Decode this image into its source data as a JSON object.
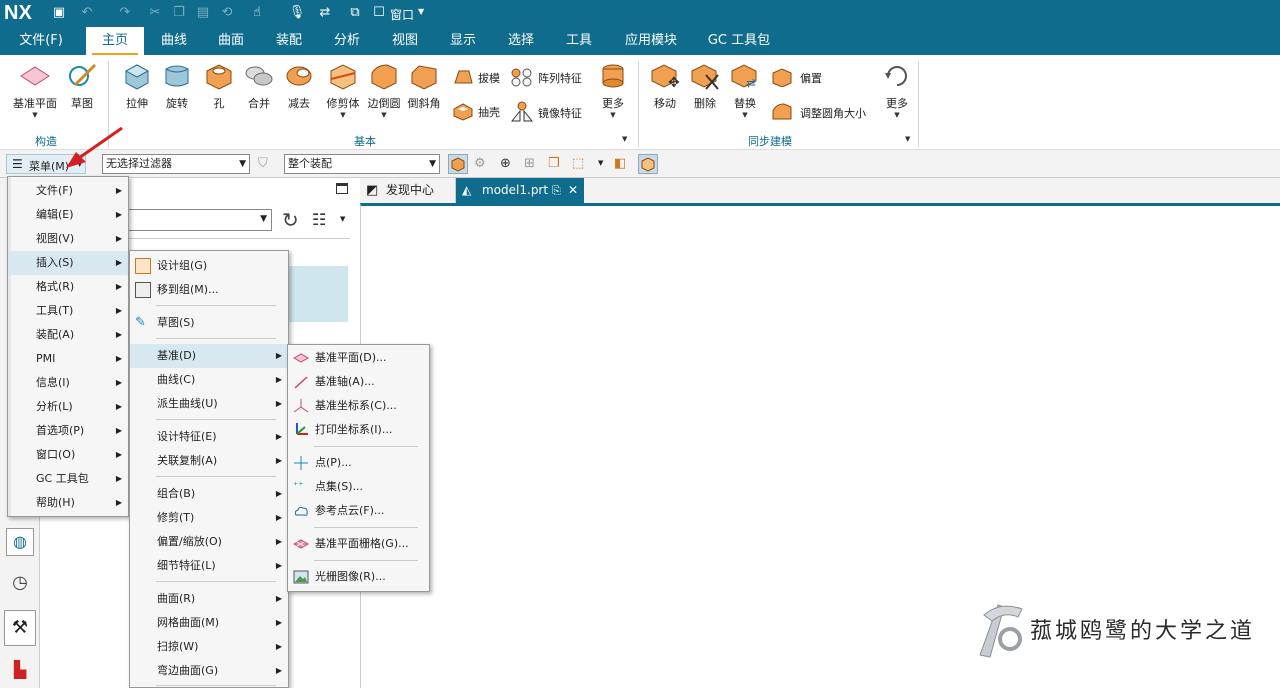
{
  "app": {
    "logo": "NX",
    "window_label": "窗口"
  },
  "menubar": [
    "文件(F)",
    "主页",
    "曲线",
    "曲面",
    "装配",
    "分析",
    "视图",
    "显示",
    "选择",
    "工具",
    "应用模块",
    "GC 工具包"
  ],
  "ribbon": {
    "construct": {
      "datum_plane": "基准平面",
      "sketch": "草图",
      "group": "构造"
    },
    "basic": {
      "extrude": "拉伸",
      "revolve": "旋转",
      "hole": "孔",
      "unite": "合并",
      "subtract": "减去",
      "trim_body": "修剪体",
      "edge_blend": "边倒圆",
      "chamfer": "倒斜角",
      "draft": "拔模",
      "shell": "抽壳",
      "pattern": "阵列特征",
      "mirror": "镜像特征",
      "more": "更多",
      "group": "基本"
    },
    "sync": {
      "move": "移动",
      "delete": "删除",
      "replace": "替换",
      "offset": "偏置",
      "resize_blend": "调整圆角大小",
      "more": "更多",
      "group": "同步建模"
    }
  },
  "toolbar": {
    "menu_button": "菜单(M)",
    "filter": "无选择过滤器",
    "scope": "整个装配"
  },
  "tabs": {
    "discovery": "发现中心",
    "model": "model1.prt"
  },
  "main_menu": [
    "文件(F)",
    "编辑(E)",
    "视图(V)",
    "插入(S)",
    "格式(R)",
    "工具(T)",
    "装配(A)",
    "PMI",
    "信息(I)",
    "分析(L)",
    "首选项(P)",
    "窗口(O)",
    "GC 工具包",
    "帮助(H)"
  ],
  "insert_menu": [
    "设计组(G)",
    "移到组(M)...",
    "草图(S)",
    "基准(D)",
    "曲线(C)",
    "派生曲线(U)",
    "设计特征(E)",
    "关联复制(A)",
    "组合(B)",
    "修剪(T)",
    "偏置/缩放(O)",
    "细节特征(L)",
    "曲面(R)",
    "网格曲面(M)",
    "扫掠(W)",
    "弯边曲面(G)"
  ],
  "datum_menu": [
    "基准平面(D)...",
    "基准轴(A)...",
    "基准坐标系(C)...",
    "打印坐标系(I)...",
    "点(P)...",
    "点集(S)...",
    "参考点云(F)...",
    "基准平面栅格(G)...",
    "光栅图像(R)..."
  ],
  "watermark": "菰城鸥鹭的大学之道",
  "colors": {
    "brand": "#0f6c8c",
    "accent": "#f0a01e",
    "menu_highlight": "#d8e8f0",
    "arrow": "#d42020"
  }
}
